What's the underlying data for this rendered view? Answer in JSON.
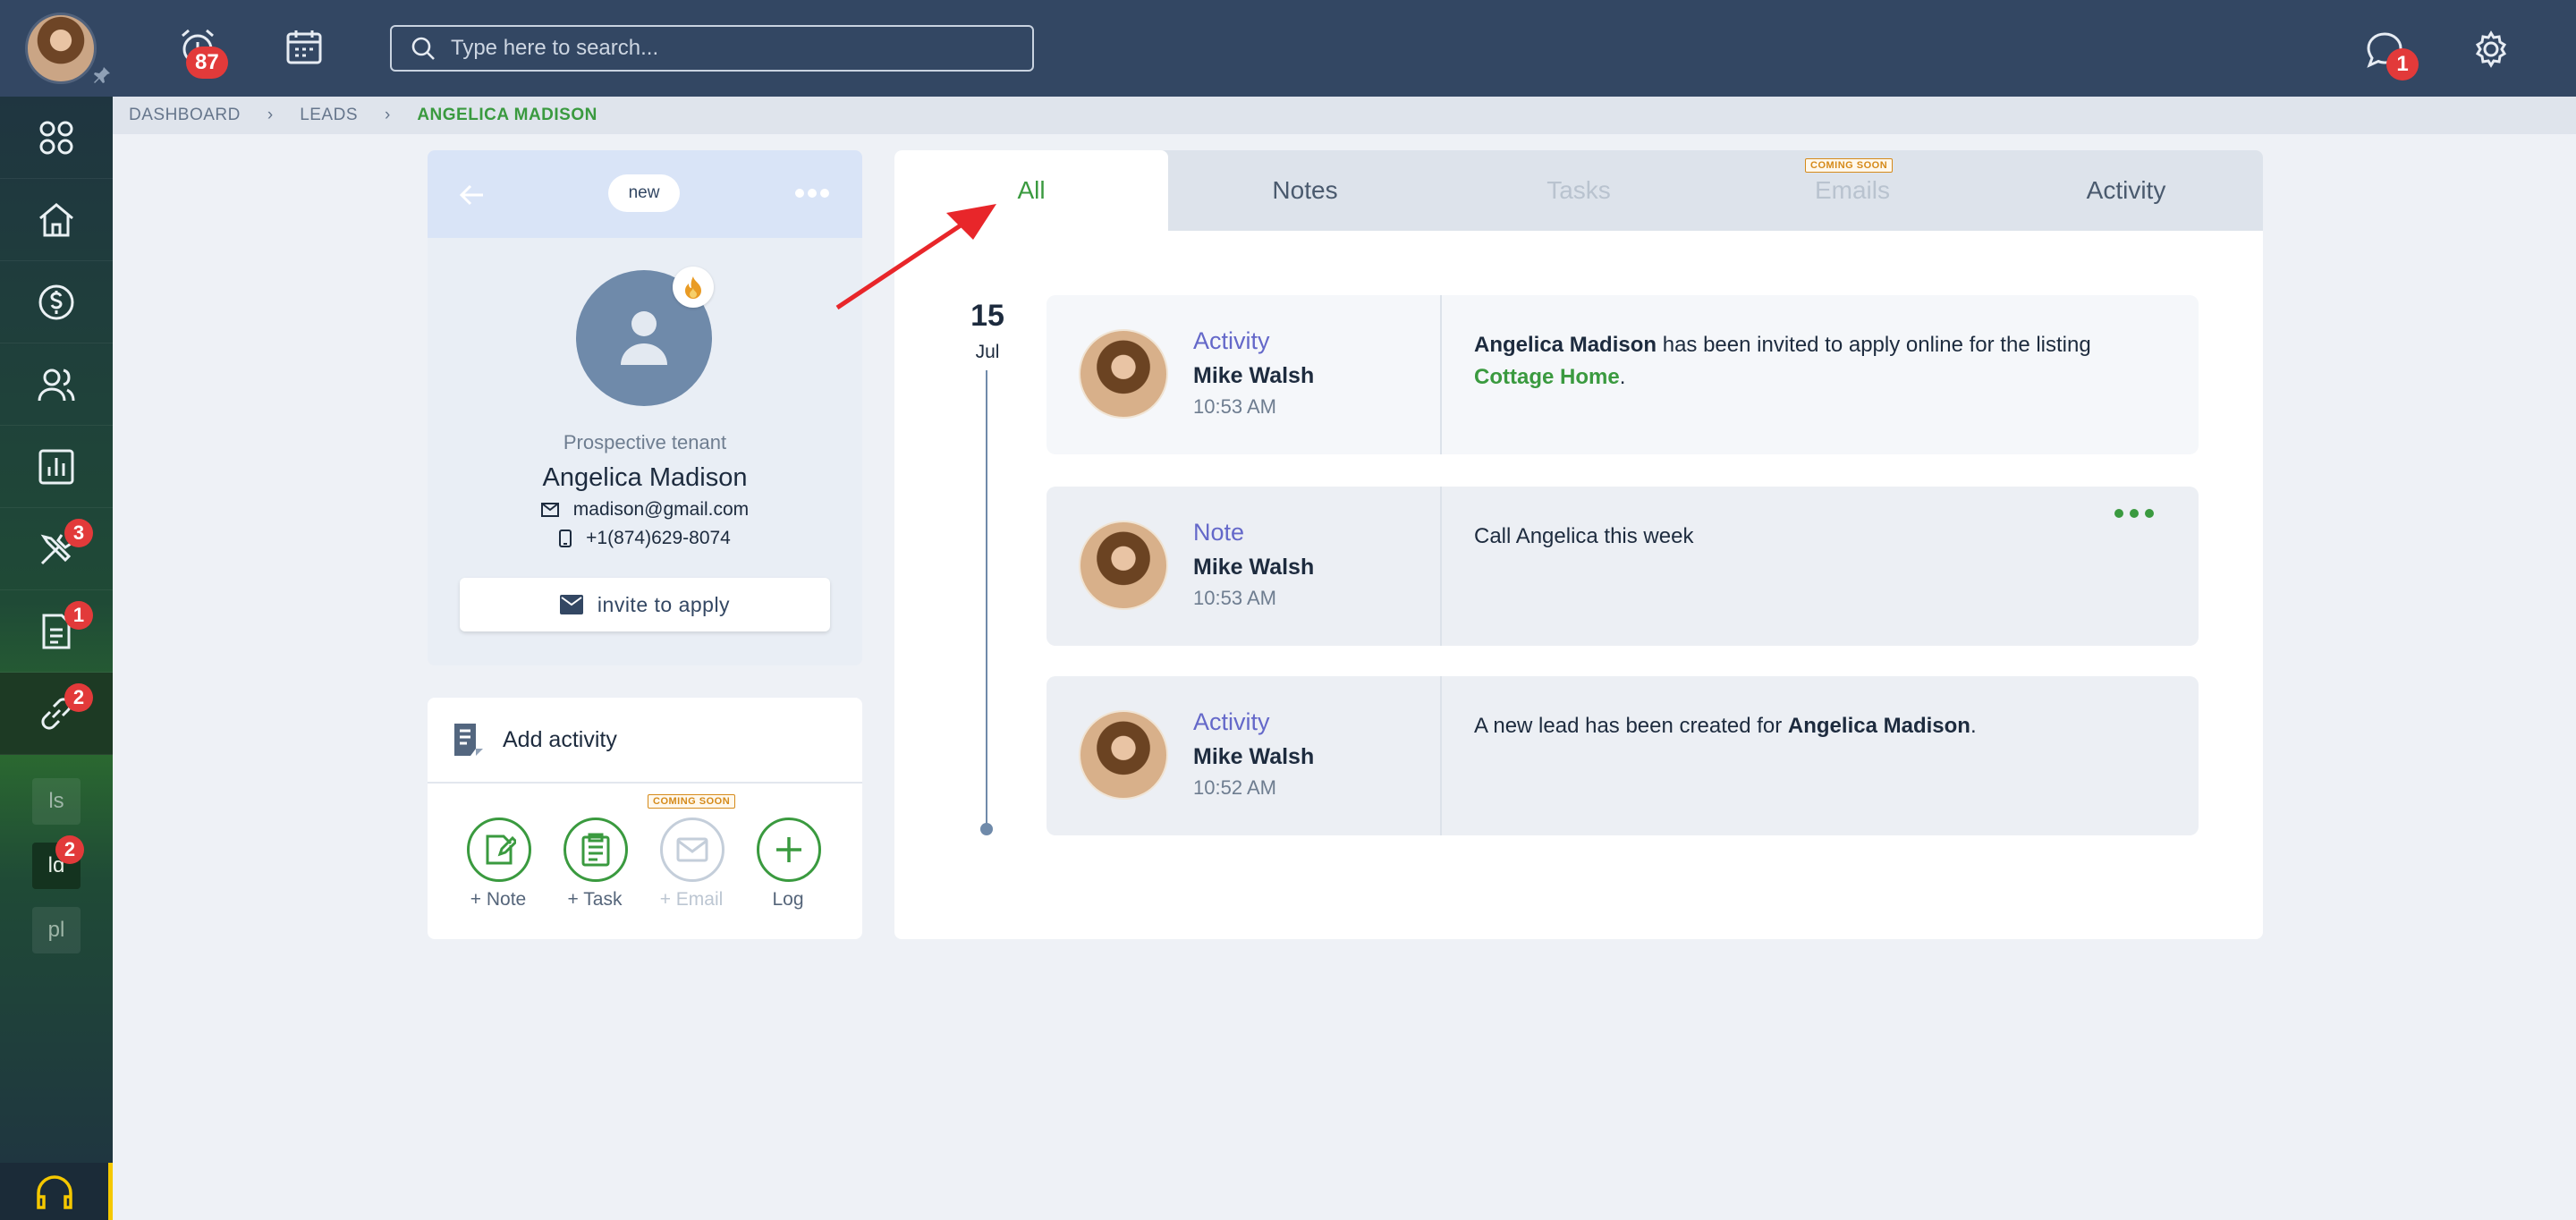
{
  "topbar": {
    "notifications_count": "87",
    "search_placeholder": "Type here to search...",
    "messages_count": "1"
  },
  "sidebar": {
    "badges": {
      "tools": "3",
      "documents": "1",
      "links": "2",
      "sub_ld": "2"
    },
    "sub_items": [
      "ls",
      "ld",
      "pl"
    ]
  },
  "breadcrumb": {
    "items": [
      "DASHBOARD",
      "LEADS"
    ],
    "current": "ANGELICA MADISON"
  },
  "profile": {
    "status": "new",
    "role": "Prospective tenant",
    "name": "Angelica Madison",
    "email": "madison@gmail.com",
    "phone": "+1(874)629-8074",
    "invite_label": "invite to apply"
  },
  "add_activity": {
    "title": "Add activity",
    "coming_soon": "COMING SOON",
    "actions": [
      {
        "label": "+ Note",
        "enabled": true
      },
      {
        "label": "+ Task",
        "enabled": true
      },
      {
        "label": "+ Email",
        "enabled": false
      },
      {
        "label": "Log",
        "enabled": true
      }
    ]
  },
  "timeline": {
    "tabs": [
      {
        "label": "All",
        "state": "active"
      },
      {
        "label": "Notes",
        "state": "normal"
      },
      {
        "label": "Tasks",
        "state": "disabled"
      },
      {
        "label": "Emails",
        "state": "disabled"
      },
      {
        "label": "Activity",
        "state": "normal"
      }
    ],
    "emails_coming_soon": "COMING SOON",
    "date_day": "15",
    "date_month": "Jul",
    "entries": [
      {
        "type": "Activity",
        "author": "Mike Walsh",
        "time": "10:53 AM",
        "text_bold": "Angelica Madison",
        "text_mid": " has been invited to apply online for the listing ",
        "text_link": "Cottage Home",
        "text_end": "."
      },
      {
        "type": "Note",
        "author": "Mike Walsh",
        "time": "10:53 AM",
        "text": "Call Angelica this week"
      },
      {
        "type": "Activity",
        "author": "Mike Walsh",
        "time": "10:52 AM",
        "text_start": "A new lead has been created for ",
        "text_bold": "Angelica Madison",
        "text_end": "."
      }
    ]
  },
  "colors": {
    "topbar": "#334763",
    "accent_green": "#3a9a3f",
    "badge_red": "#e23a3a",
    "entry_type": "#6468c9",
    "annotation_arrow": "#e8262a"
  }
}
